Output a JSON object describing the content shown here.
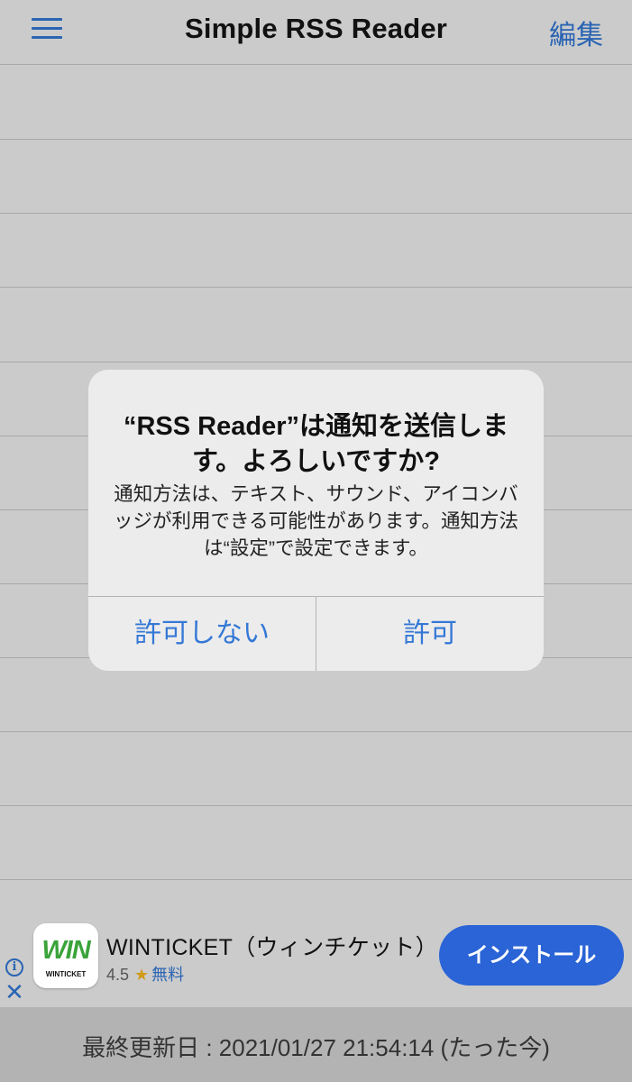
{
  "navbar": {
    "title": "Simple RSS Reader",
    "edit_label": "編集"
  },
  "alert": {
    "title": "“RSS Reader”は通知を送信します。よろしいですか?",
    "message": "通知方法は、テキスト、サウンド、アイコンバッジが利用できる可能性があります。通知方法は“設定”で設定できます。",
    "deny_label": "許可しない",
    "allow_label": "許可"
  },
  "ad": {
    "logo_text": "WIN",
    "logo_subtext": "WINTICKET",
    "app_name": "WINTICKET（ウィンチケット）",
    "rating": "4.5",
    "star": "★",
    "price": "無料",
    "install_label": "インストール",
    "info_symbol": "i",
    "close_symbol": "✕"
  },
  "footer": {
    "last_updated": "最終更新日 : 2021/01/27 21:54:14 (たった今)"
  },
  "colors": {
    "accent": "#2a64b3",
    "alert_button": "#3478d6",
    "install_button": "#2a64d6",
    "star": "#d19a16",
    "logo_green": "#3aa33a"
  }
}
